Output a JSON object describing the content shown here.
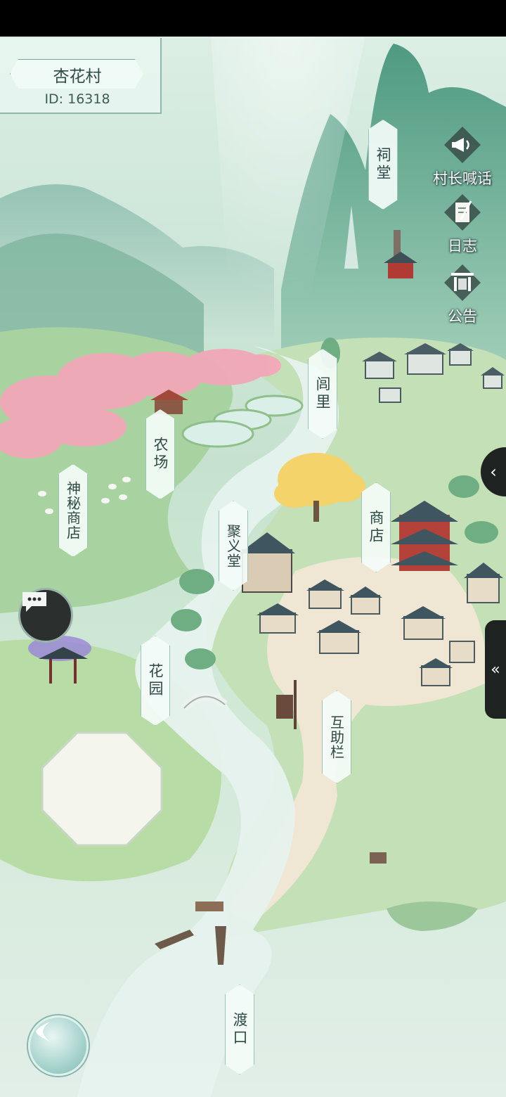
{
  "village": {
    "name": "杏花村",
    "id_text": "ID: 16318"
  },
  "locations": {
    "ci_tang": "祠堂",
    "lv_li": "闾里",
    "nong_chang": "农场",
    "shen_mi_shang_dian": "神秘商店",
    "ju_yi_tang": "聚义堂",
    "shang_dian": "商店",
    "hua_yuan": "花园",
    "hu_zhu_lan": "互助栏",
    "du_kou": "渡口"
  },
  "side_menu": {
    "chief_shout": {
      "label": "村长喊话",
      "icon": "megaphone-icon"
    },
    "log": {
      "label": "日志",
      "icon": "scroll-quill-icon"
    },
    "notice": {
      "label": "公告",
      "icon": "pavilion-board-icon"
    }
  },
  "colors": {
    "plaque_border": "#9cc4b8",
    "blossom": "#f2a7b8",
    "ginkgo": "#f3d36a",
    "water": "#e6f2ee",
    "grass": "#b9dcb0"
  }
}
